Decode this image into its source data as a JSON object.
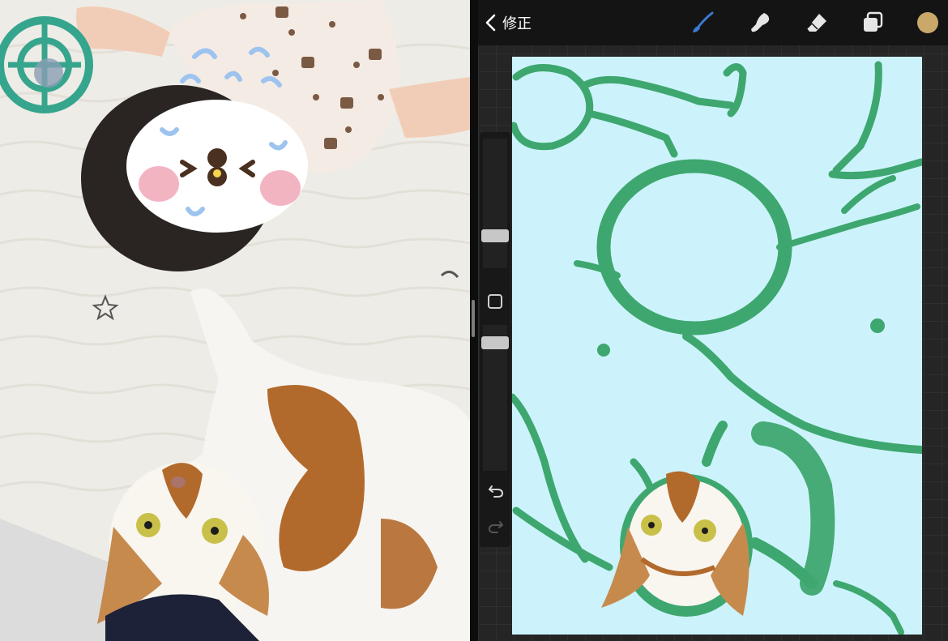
{
  "app": {
    "back_label": "修正",
    "tools": {
      "brush": "brush-icon",
      "smudge": "smudge-icon",
      "eraser": "eraser-icon",
      "layers": "layers-icon"
    },
    "current_color": "#c9a86a",
    "brush_color": "#3b7bd6",
    "canvas_background": "#ccf3fb",
    "sketch_color": "#3ea76f"
  },
  "side_panel": {
    "undo_icon": "undo-icon",
    "redo_icon": "redo-icon",
    "modify_icon": "square-icon"
  },
  "photo": {
    "sticker_bg": "#ffffff",
    "blanket_color": "#f1efe9",
    "cat_patch_color": "#b26a2c"
  }
}
